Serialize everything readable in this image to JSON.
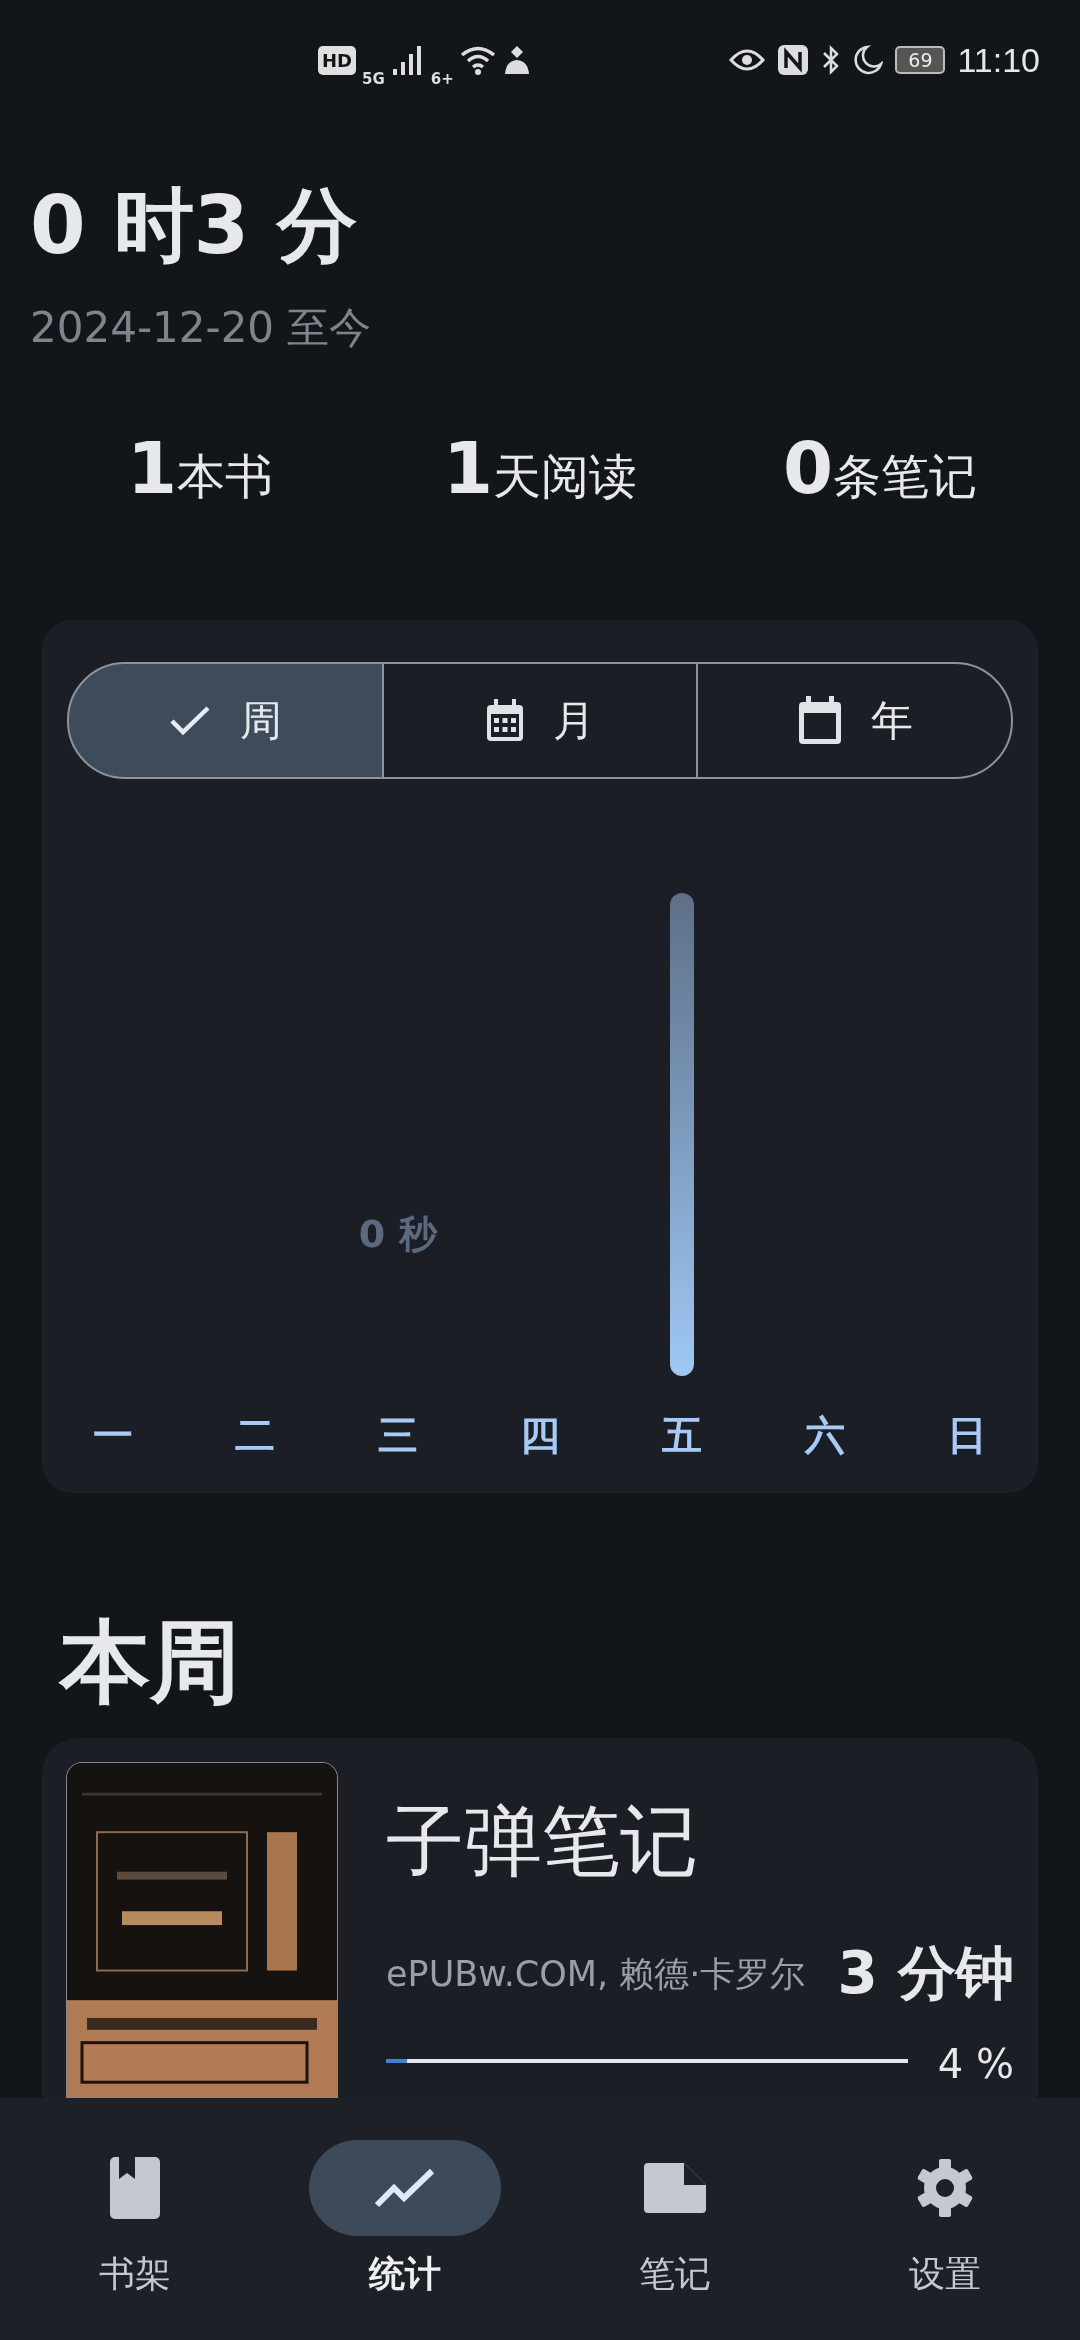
{
  "status_bar": {
    "hd": "HD",
    "network": "5G",
    "wifi": "6+",
    "battery": "69",
    "time": "11:10"
  },
  "summary": {
    "total": "0 时3 分",
    "since": "2024-12-20 至今"
  },
  "stats": [
    {
      "value": "1",
      "label": "本书"
    },
    {
      "value": "1",
      "label": "天阅读"
    },
    {
      "value": "0",
      "label": "条笔记"
    }
  ],
  "period_tabs": [
    {
      "label": "周",
      "selected": true
    },
    {
      "label": "月",
      "selected": false
    },
    {
      "label": "年",
      "selected": false
    }
  ],
  "week_chart": {
    "days": [
      {
        "label": "一",
        "kind": "empty"
      },
      {
        "label": "二",
        "kind": "empty"
      },
      {
        "label": "三",
        "kind": "empty",
        "value_label": "0 秒"
      },
      {
        "label": "四",
        "kind": "empty"
      },
      {
        "label": "五",
        "kind": "bar"
      },
      {
        "label": "六",
        "kind": "empty"
      },
      {
        "label": "日",
        "kind": "empty"
      }
    ]
  },
  "section_title": "本周",
  "books": [
    {
      "title": "子弹笔记",
      "author": "ePUBw.COM, 赖德·卡罗尔",
      "time": "3 分钟",
      "level": 0.04,
      "percent": "4 %"
    }
  ],
  "nav": [
    {
      "label": "书架",
      "selected": false
    },
    {
      "label": "统计",
      "selected": true
    },
    {
      "label": "笔记",
      "selected": false
    },
    {
      "label": "设置",
      "selected": false
    }
  ]
}
